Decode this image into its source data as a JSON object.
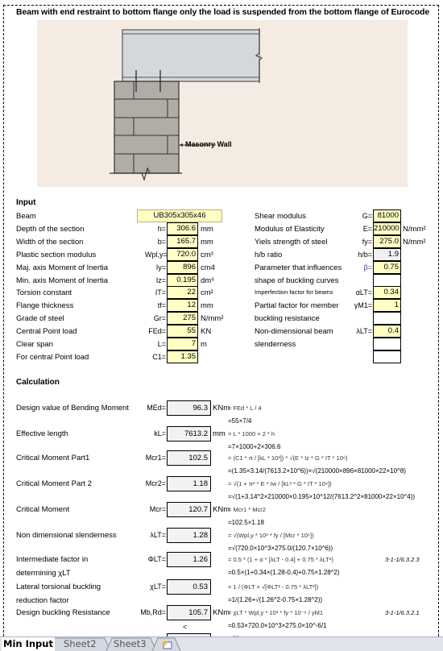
{
  "title": "Beam with end restraint to bottom flange only the load is suspended from the bottom flange of Eurocode",
  "figure": {
    "callout": "Masonry Wall",
    "colors": {
      "background": "#f4ebe2",
      "beam": "#d5d8db",
      "wall": "#b0aca6"
    }
  },
  "input": {
    "heading": "Input",
    "beam": {
      "label": "Beam",
      "value": "UB305x305x46"
    },
    "left": [
      {
        "label": "Depth of the section",
        "symbol": "h=",
        "value": "306.6",
        "unit": "mm"
      },
      {
        "label": "Width of the section",
        "symbol": "b=",
        "value": "165.7",
        "unit": "mm"
      },
      {
        "label": "Plastic section modulus",
        "symbol": "Wpl,y=",
        "value": "720.0",
        "unit": "cm³"
      },
      {
        "label": "Maj. axis Moment of Inertia",
        "symbol": "Iy=",
        "value": "896",
        "unit": "cm4"
      },
      {
        "label": "Min. axis Moment of Inertia",
        "symbol": "Iz=",
        "value": "0.195",
        "unit": "dm⁶"
      },
      {
        "label": "Torsion constant",
        "symbol": "IT=",
        "value": "22",
        "unit": "cm²"
      },
      {
        "label": "Flange thickness",
        "symbol": "tf=",
        "value": "12",
        "unit": "mm"
      },
      {
        "label": "Grade of steel",
        "symbol": "Gr=",
        "value": "275",
        "unit": "N/mm²"
      },
      {
        "label": "Central Point load",
        "symbol": "FEd=",
        "value": "55",
        "unit": "KN"
      },
      {
        "label": "Clear span",
        "symbol": "L=",
        "value": "7",
        "unit": "m"
      },
      {
        "label": "For central Point load",
        "symbol": "C1=",
        "value": "1.35",
        "unit": ""
      }
    ],
    "right": [
      {
        "label": "Shear modulus",
        "symbol": "G=",
        "value": "81000",
        "unit": "",
        "style": "yellow"
      },
      {
        "label": "Modulus of Elasticity",
        "symbol": "E=",
        "value": "210000",
        "unit": "N/mm²",
        "style": "yellow"
      },
      {
        "label": "Yiels strength of steel",
        "symbol": "fy=",
        "value": "275.0",
        "unit": "N/mm²",
        "style": "yellow"
      },
      {
        "label": "h/b ratio",
        "symbol": "h/b=",
        "value": "1.9",
        "unit": "",
        "style": "grey"
      },
      {
        "label": "Parameter that influences",
        "symbol": "β=",
        "value": "0.75",
        "unit": "",
        "style": "yellow"
      },
      {
        "label": "shape of buckling curves",
        "symbol": "",
        "value": "",
        "unit": "",
        "style": "white"
      },
      {
        "label": "Imperfection factor for beams",
        "symbol": "αLT=",
        "value": "0.34",
        "unit": "",
        "style": "yellow"
      },
      {
        "label": "Partial factor for member",
        "symbol": "γM1=",
        "value": "1",
        "unit": "",
        "style": "yellow"
      },
      {
        "label": "buckling resistance",
        "symbol": "",
        "value": "",
        "unit": "",
        "style": "white"
      },
      {
        "label": "Non-dimensional beam",
        "symbol": "λLT=",
        "value": "0.4",
        "unit": "",
        "style": "yellow"
      },
      {
        "label": "slenderness",
        "symbol": "",
        "value": "",
        "unit": "",
        "style": "white"
      },
      {
        "label": "",
        "symbol": "",
        "value": "",
        "unit": "",
        "style": "white"
      }
    ]
  },
  "calculation": {
    "heading": "Calculation",
    "rows": [
      {
        "label": "Design value of Bending Moment",
        "label2": "",
        "symbol": "MEd=",
        "value": "96.3",
        "unit": "KNm",
        "formula": "= FEd * L / 4",
        "evaluated": "=55×7/4",
        "ref": ""
      },
      {
        "label": "Effective length",
        "label2": "",
        "symbol": "kL=",
        "value": "7613.2",
        "unit": "mm",
        "formula": "= L * 1000 + 2 * h",
        "evaluated": "=7×1000+2×306.6",
        "ref": ""
      },
      {
        "label": "Critical Moment Part1",
        "label2": "",
        "symbol": "Mcr1=",
        "value": "102.5",
        "unit": "",
        "formula": "= (C1 * π / [kL * 10³]) * √(E * Iz * G * IT * 10⁸)",
        "evaluated": "=(1.35×3.14/(7613.2×10^6))×√(210000×896×81000×22×10^8)",
        "ref": ""
      },
      {
        "label": "Critical Moment Part 2",
        "label2": "",
        "symbol": "Mcr2=",
        "value": "1.18",
        "unit": "",
        "formula": "= √(1 + π² * E * Iw / [kL² * G * IT * 10⁴])",
        "evaluated": "=√(1+3.14^2×210000×0.195×10^12/(7613.2^2×81000×22×10^4))",
        "ref": ""
      },
      {
        "label": "Critical Moment",
        "label2": "",
        "symbol": "Mcr=",
        "value": "120.7",
        "unit": "KNm",
        "formula": "= Mcr1 * Mcr2",
        "evaluated": "=102.5×1.18",
        "ref": ""
      },
      {
        "label": "Non dimensional slenderness",
        "label2": "",
        "symbol": "λLT=",
        "value": "1.28",
        "unit": "",
        "formula": "= √(Wpl,y * 10³ * fy / [Mcr * 10⁶])",
        "evaluated": "=√(720.0×10^3×275.0/(120.7×10^6))",
        "ref": ""
      },
      {
        "label": "Intermediate factor in",
        "label2": "determining χLT",
        "symbol": "ΦLT=",
        "value": "1.26",
        "unit": "",
        "formula": "= 0.5 * (1 + α * [λLT - 0.4] + 0.75 * λLT²)",
        "evaluated": "=0.5×(1+0.34×(1.28-0.4)+0.75×1.28^2)",
        "ref": "3-1-1/6.3.2.3"
      },
      {
        "label": "Lateral torsional buckling",
        "label2": "reduction factor",
        "symbol": "χLT=",
        "value": "0.53",
        "unit": "",
        "formula": "= 1 / (ΦLT + √[ΦLT² - 0.75 * λLT²])",
        "evaluated": "=1/(1.26+√(1.26^2-0.75×1.28^2))",
        "ref": ""
      },
      {
        "label": "Design buckling Resistance",
        "label2": "",
        "symbol": "Mb,Rd=",
        "value": "105.7",
        "unit": "KNm",
        "formula": "= χLT * Wpl,y * 10³ * fy * 10⁻⁶ / γM1",
        "evaluated": "=0.53×720.0×10^3×275.0×10^-6/1",
        "ref": "3-1-1/6.3.2.1"
      }
    ],
    "compare": "<",
    "next_formula": "= M"
  },
  "sheet_tabs": [
    {
      "label": "Min Input",
      "active": true
    },
    {
      "label": "Sheet2",
      "active": false
    },
    {
      "label": "Sheet3",
      "active": false
    }
  ],
  "new_sheet_icon": "insert-worksheet-icon"
}
